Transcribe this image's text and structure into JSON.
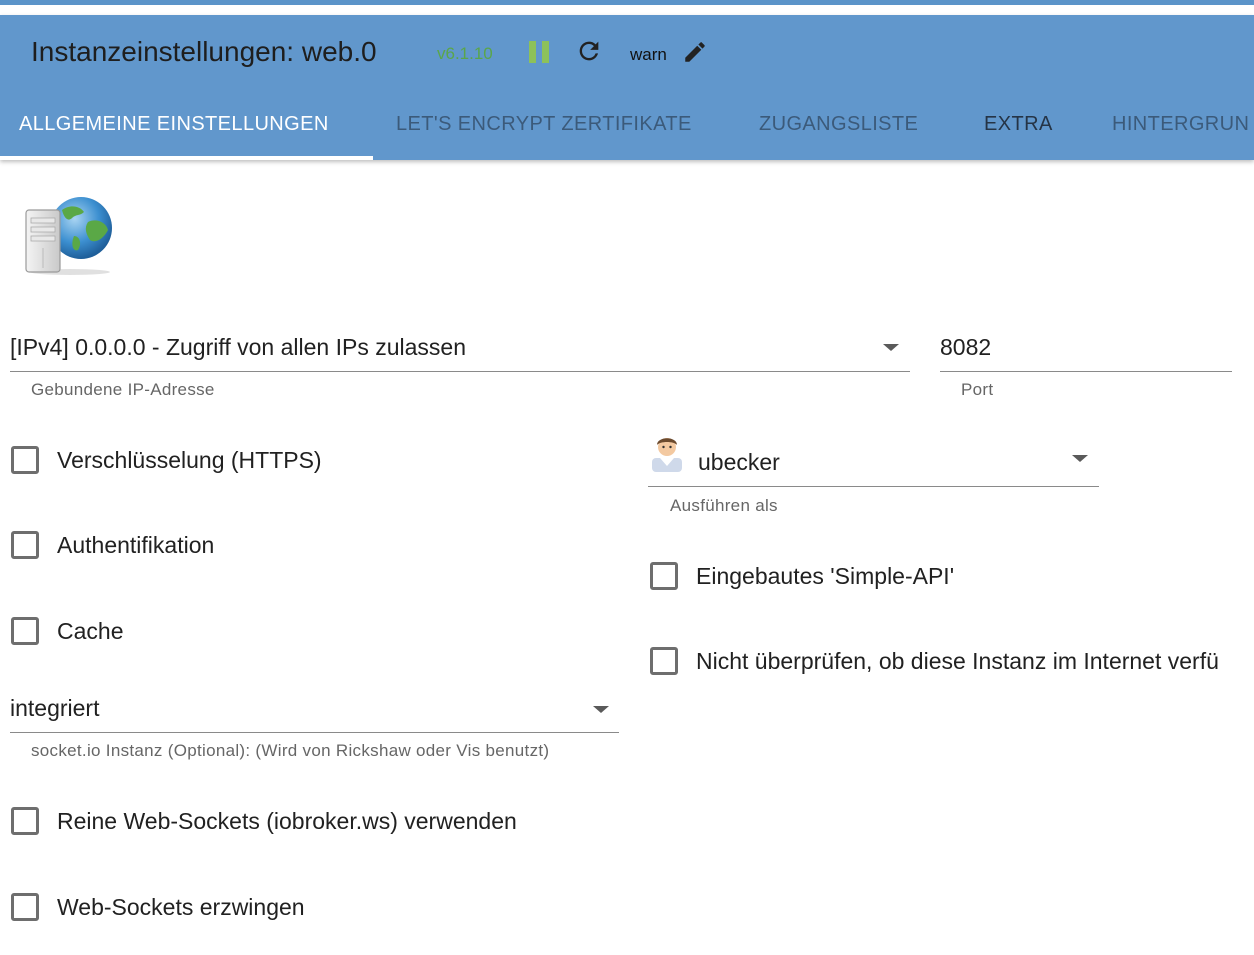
{
  "header": {
    "title": "Instanzeinstellungen: web.0",
    "version": "v6.1.10",
    "log_level": "warn",
    "icons": [
      "pause-icon",
      "refresh-icon",
      "edit-icon"
    ]
  },
  "tabs": [
    {
      "label": "ALLGEMEINE EINSTELLUNGEN",
      "active": true
    },
    {
      "label": "LET'S ENCRYPT ZERTIFIKATE",
      "active": false
    },
    {
      "label": "ZUGANGSLISTE",
      "active": false
    },
    {
      "label": "EXTRA",
      "active": false
    },
    {
      "label": "HINTERGRUN",
      "active": false
    }
  ],
  "form": {
    "bind_ip": {
      "value": "[IPv4] 0.0.0.0 - Zugriff von allen IPs zulassen",
      "helper": "Gebundene IP-Adresse"
    },
    "port": {
      "value": "8082",
      "helper": "Port"
    },
    "run_as": {
      "value": "ubecker",
      "helper": "Ausführen als"
    },
    "socketio": {
      "value": "integriert",
      "helper": "socket.io Instanz (Optional): (Wird von Rickshaw oder Vis benutzt)"
    },
    "checkboxes": {
      "https": {
        "label": "Verschlüsselung (HTTPS)",
        "checked": false
      },
      "auth": {
        "label": "Authentifikation",
        "checked": false
      },
      "cache": {
        "label": "Cache",
        "checked": false
      },
      "simple_api": {
        "label": "Eingebautes 'Simple-API'",
        "checked": false
      },
      "no_check": {
        "label": "Nicht überprüfen, ob diese Instanz im Internet verfü",
        "checked": false
      },
      "pure_ws": {
        "label": "Reine Web-Sockets (iobroker.ws) verwenden",
        "checked": false
      },
      "force_ws": {
        "label": "Web-Sockets erzwingen",
        "checked": false
      }
    }
  },
  "colors": {
    "header_bg": "#6197cc",
    "version": "#5aa64a",
    "pause": "#8dc15a"
  }
}
